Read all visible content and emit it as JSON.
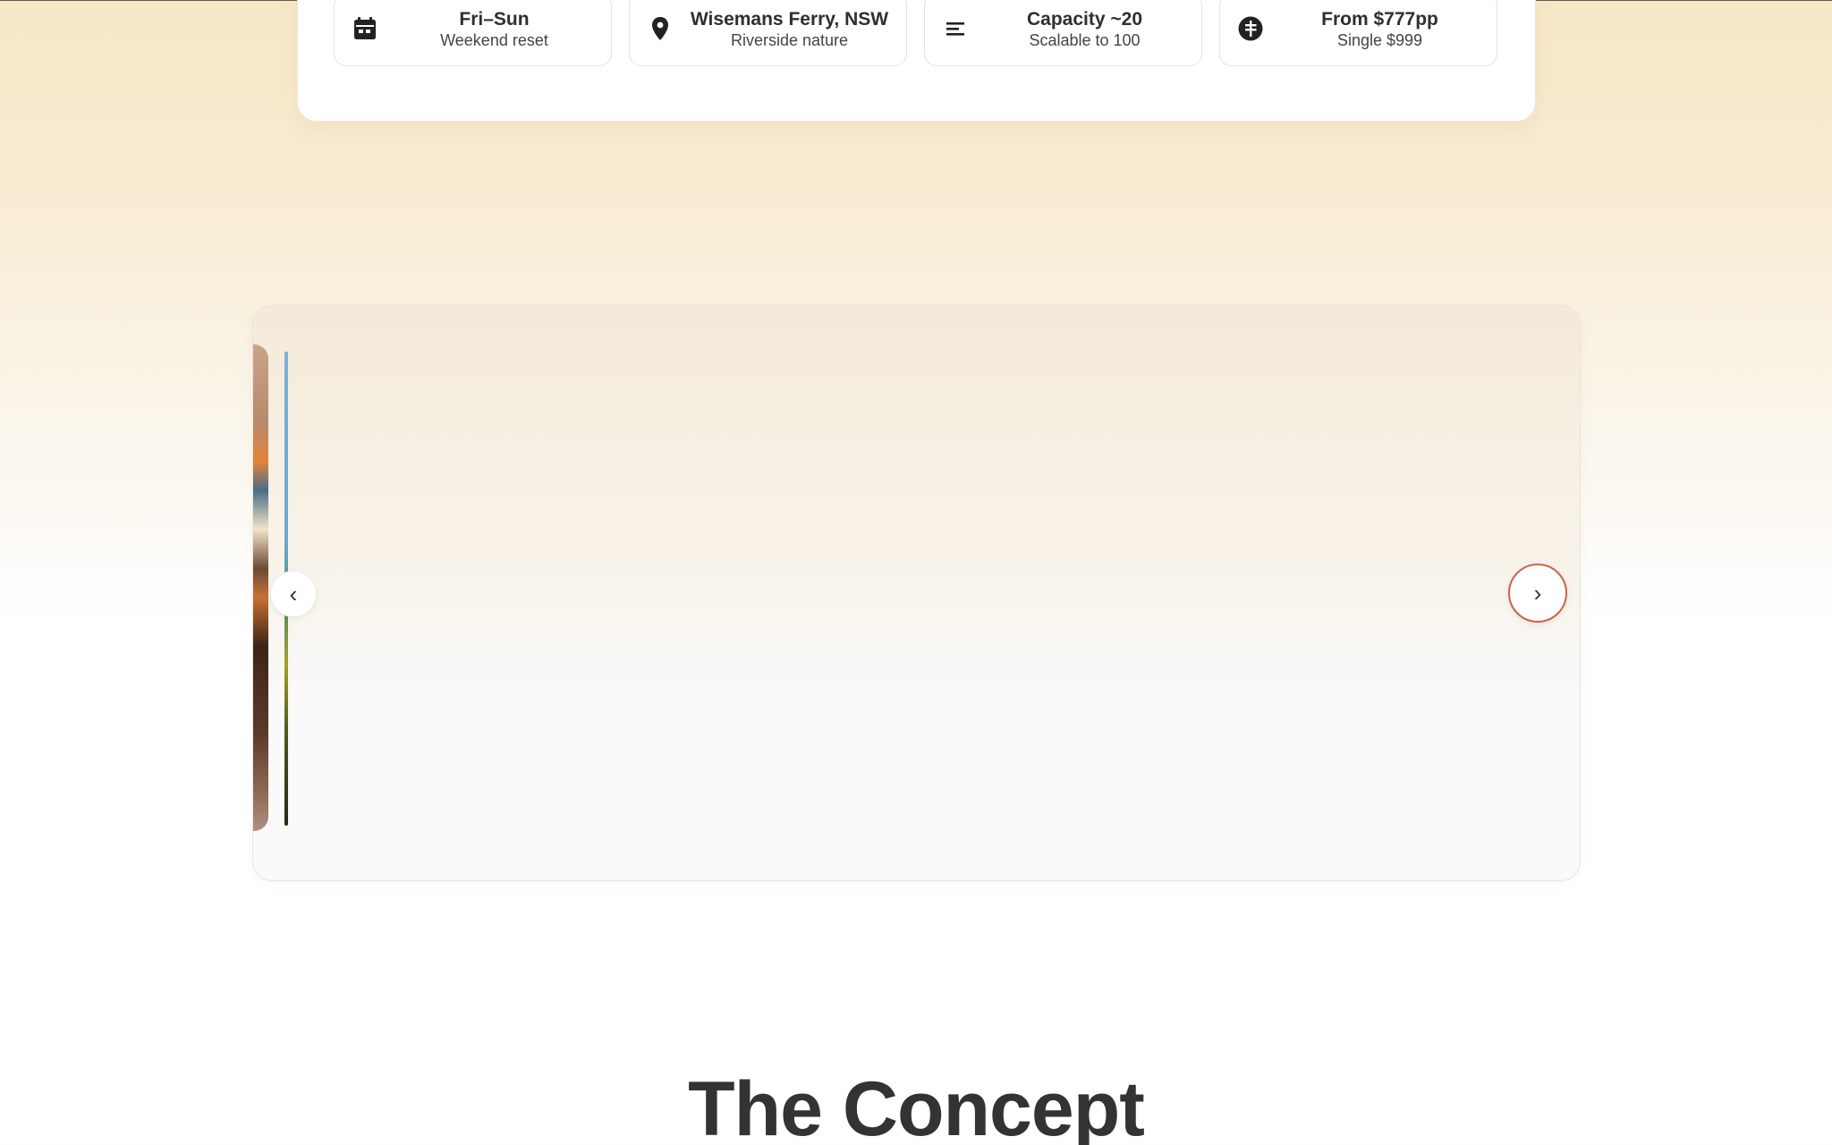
{
  "info_cards": [
    {
      "icon": "calendar-icon",
      "title": "Fri–Sun",
      "subtitle": "Weekend reset"
    },
    {
      "icon": "location-pin-icon",
      "title": "Wisemans Ferry, NSW",
      "subtitle": "Riverside nature"
    },
    {
      "icon": "lines-icon",
      "title": "Capacity ~20",
      "subtitle": "Scalable to 100"
    },
    {
      "icon": "dollar-icon",
      "title": "From $777pp",
      "subtitle": "Single $999"
    }
  ],
  "carousel": {
    "prev_label": "‹",
    "next_label": "›"
  },
  "concept": {
    "heading": "The Concept"
  },
  "colors": {
    "accent": "#c8644a",
    "text": "#2f2f2f",
    "background_top": "#f7e8c6"
  }
}
